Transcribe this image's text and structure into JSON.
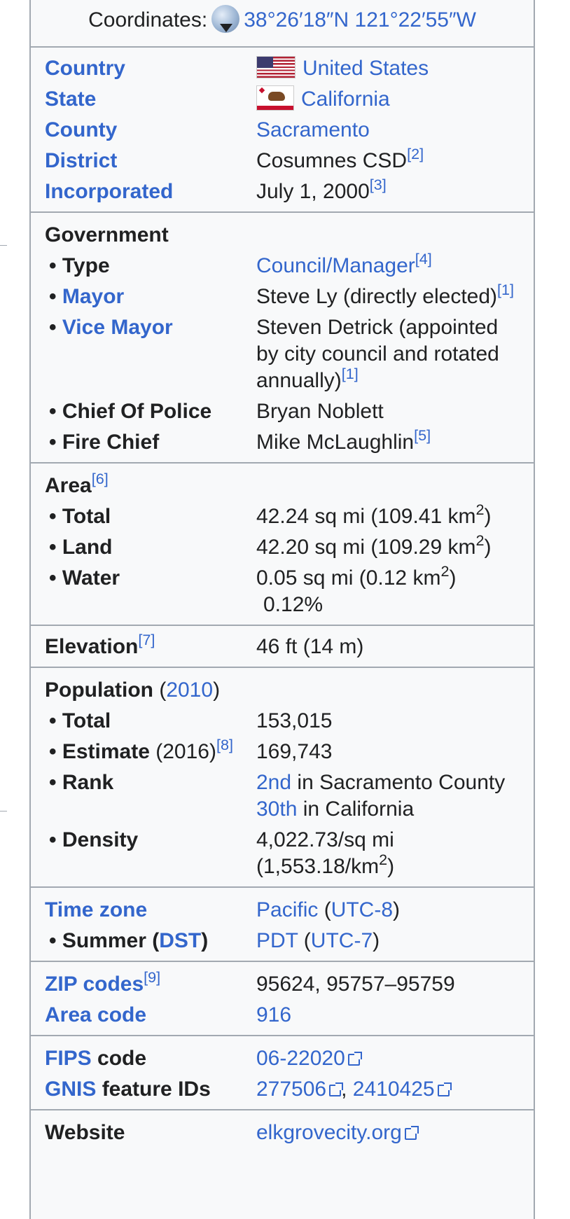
{
  "coordinates": {
    "label": "Coordinates:",
    "value": "38°26′18″N 121°22′55″W"
  },
  "general": {
    "country": {
      "label": "Country",
      "value": "United States"
    },
    "state": {
      "label": "State",
      "value": "California"
    },
    "county": {
      "label": "County",
      "value": "Sacramento"
    },
    "district": {
      "label": "District",
      "value": "Cosumnes CSD",
      "ref": "[2]"
    },
    "incorporated": {
      "label": "Incorporated",
      "value": "July 1, 2000",
      "ref": "[3]"
    }
  },
  "government": {
    "heading": "Government",
    "type": {
      "label": "• Type",
      "value": "Council/Manager",
      "ref": "[4]"
    },
    "mayor": {
      "bullet": "• ",
      "label": "Mayor",
      "value": "Steve Ly (directly elected)",
      "ref": "[1]"
    },
    "vice_mayor": {
      "bullet": "• ",
      "label": "Vice Mayor",
      "value": "Steven Detrick (appointed by city council and rotated annually)",
      "ref": "[1]"
    },
    "chief_police": {
      "label": "• Chief Of Police",
      "value": "Bryan Noblett"
    },
    "fire_chief": {
      "label": "• Fire Chief",
      "value": "Mike McLaughlin",
      "ref": "[5]"
    }
  },
  "area": {
    "heading": "Area",
    "ref": "[6]",
    "total": {
      "label": "• Total",
      "value": "42.24 sq mi (109.41 km",
      "exp": "2",
      "tail": ")"
    },
    "land": {
      "label": "• Land",
      "value": "42.20 sq mi (109.29 km",
      "exp": "2",
      "tail": ")"
    },
    "water": {
      "label": "• Water",
      "value": "0.05 sq mi (0.12 km",
      "exp": "2",
      "tail": ")",
      "percent": "0.12%"
    }
  },
  "elevation": {
    "label": "Elevation",
    "ref": "[7]",
    "value": "46 ft (14 m)"
  },
  "population": {
    "heading": "Population",
    "year_open": " (",
    "year": "2010",
    "year_close": ")",
    "total": {
      "label": "• Total",
      "value": "153,015"
    },
    "estimate": {
      "label": "• Estimate",
      "year": " (2016)",
      "ref": "[8]",
      "value": "169,743"
    },
    "rank": {
      "label": "• Rank",
      "rank1": "2nd",
      "rank1_text": " in Sacramento County",
      "rank2": "30th",
      "rank2_text": " in California"
    },
    "density": {
      "label": "• Density",
      "value": "4,022.73/sq mi (1,553.18/km",
      "exp": "2",
      "tail": ")"
    }
  },
  "timezone": {
    "label": "Time zone",
    "zone": "Pacific",
    "offset": "UTC-8",
    "summer_label": "• Summer (",
    "summer_dst": "DST",
    "summer_close": ")",
    "summer_zone": "PDT",
    "summer_offset": "UTC-7"
  },
  "codes": {
    "zip_label": "ZIP codes",
    "zip_ref": "[9]",
    "zip_value": "95624, 95757–95759",
    "area_code_label": "Area code",
    "area_code_value": "916"
  },
  "ids": {
    "fips_link": "FIPS",
    "fips_text": " code",
    "fips_value": "06-22020",
    "gnis_link": "GNIS",
    "gnis_text": " feature IDs",
    "gnis_value1": "277506",
    "gnis_sep": ", ",
    "gnis_value2": "2410425"
  },
  "website": {
    "label": "Website",
    "value": "elkgrovecity.org"
  },
  "icons": [
    "globe-icon",
    "us-flag-icon",
    "california-flag-icon",
    "external-link-icon"
  ],
  "colors": {
    "link": "#3366cc",
    "border": "#a2a9b1",
    "background": "#f8f9fa",
    "text": "#202122"
  }
}
